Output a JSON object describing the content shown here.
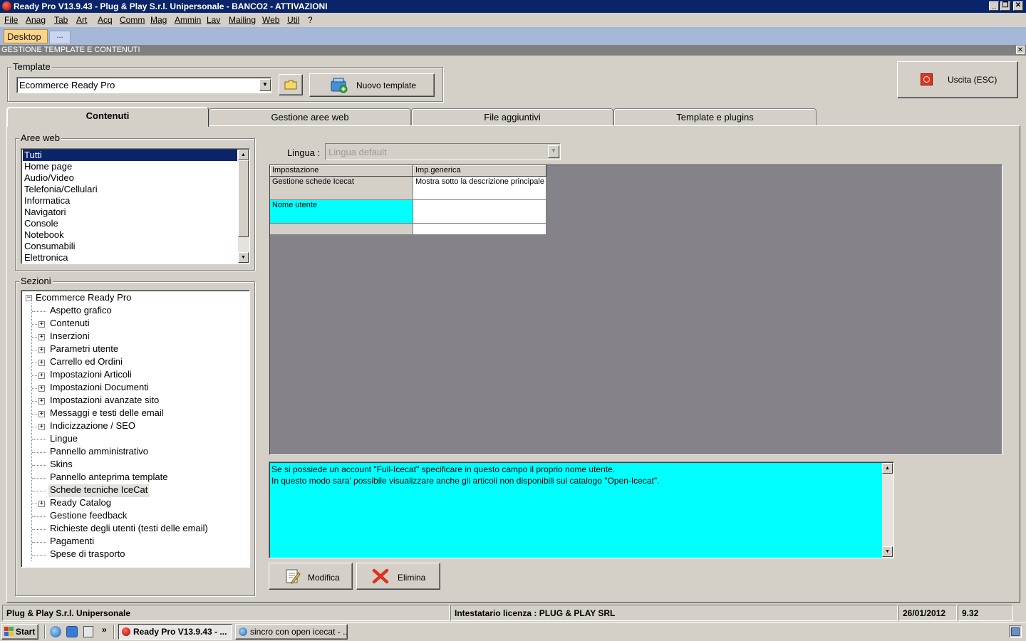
{
  "window": {
    "title": "Ready Pro V13.9.43 - Plug & Play S.r.l. Unipersonale - BANCO2 - ATTIVAZIONI"
  },
  "menu": [
    "File",
    "Anag",
    "Tab",
    "Art",
    "Acq",
    "Comm",
    "Mag",
    "Ammin",
    "Lav",
    "Mailing",
    "Web",
    "Util",
    "?"
  ],
  "desktop_tabs": {
    "active": "Desktop",
    "more": "..."
  },
  "form_title": "GESTIONE TEMPLATE E CONTENUTI",
  "template_group": {
    "label": "Template",
    "selected": "Ecommerce Ready Pro",
    "new_button": "Nuovo template"
  },
  "exit_button": "Uscita (ESC)",
  "tabs": [
    "Contenuti",
    "Gestione aree web",
    "File aggiuntivi",
    "Template e plugins"
  ],
  "aree_web": {
    "label": "Aree web",
    "items": [
      "Tutti",
      "Home page",
      "Audio/Video",
      "Telefonia/Cellulari",
      "Informatica",
      "Navigatori",
      "Console",
      "Notebook",
      "Consumabili",
      "Elettronica"
    ],
    "selected": "Tutti"
  },
  "sezioni": {
    "label": "Sezioni",
    "root": "Ecommerce Ready Pro",
    "items": [
      {
        "label": "Aspetto grafico",
        "expandable": false
      },
      {
        "label": "Contenuti",
        "expandable": true
      },
      {
        "label": "Inserzioni",
        "expandable": true
      },
      {
        "label": "Parametri utente",
        "expandable": true
      },
      {
        "label": "Carrello ed Ordini",
        "expandable": true
      },
      {
        "label": "Impostazioni Articoli",
        "expandable": true
      },
      {
        "label": "Impostazioni Documenti",
        "expandable": true
      },
      {
        "label": "Impostazioni avanzate sito",
        "expandable": true
      },
      {
        "label": "Messaggi e testi delle email",
        "expandable": true
      },
      {
        "label": "Indicizzazione / SEO",
        "expandable": true
      },
      {
        "label": "Lingue",
        "expandable": false
      },
      {
        "label": "Pannello amministrativo",
        "expandable": false
      },
      {
        "label": "Skins",
        "expandable": false
      },
      {
        "label": "Pannello anteprima template",
        "expandable": false
      },
      {
        "label": "Schede tecniche IceCat",
        "expandable": false,
        "selected": true
      },
      {
        "label": "Ready Catalog",
        "expandable": true
      },
      {
        "label": "Gestione feedback",
        "expandable": false
      },
      {
        "label": "Richieste degli utenti (testi delle email)",
        "expandable": false
      },
      {
        "label": "Pagamenti",
        "expandable": false
      },
      {
        "label": "Spese di trasporto",
        "expandable": false
      }
    ]
  },
  "lingua": {
    "label": "Lingua :",
    "value": "Lingua default"
  },
  "grid": {
    "headers": [
      "Impostazione",
      "Imp.generica"
    ],
    "rows": [
      [
        "Gestione schede Icecat",
        "Mostra sotto la descrizione principale"
      ],
      [
        "Nome utente",
        ""
      ],
      [
        "",
        ""
      ]
    ]
  },
  "description": [
    "Se si possiede un account \"Full-Icecat\" specificare in questo campo il proprio nome utente.",
    "In questo modo sara' possibile visualizzare anche gli articoli non disponibili sul catalogo \"Open-Icecat\"."
  ],
  "buttons": {
    "modifica": "Modifica",
    "elimina": "Elimina"
  },
  "status": {
    "company": "Plug & Play S.r.l. Unipersonale",
    "licensee": "Intestatario licenza : PLUG & PLAY SRL",
    "date": "26/01/2012",
    "time": "9.32"
  },
  "taskbar": {
    "start": "Start",
    "quicklaunch_more": "»",
    "tasks": [
      "Ready Pro V13.9.43 - ...",
      "sincro con open icecat - ..."
    ]
  },
  "colors": {
    "titlebar": "#0a246a",
    "selection": "#0a246a",
    "highlight_cell": "#00ffff",
    "desktop_tab": "#fbd488"
  }
}
